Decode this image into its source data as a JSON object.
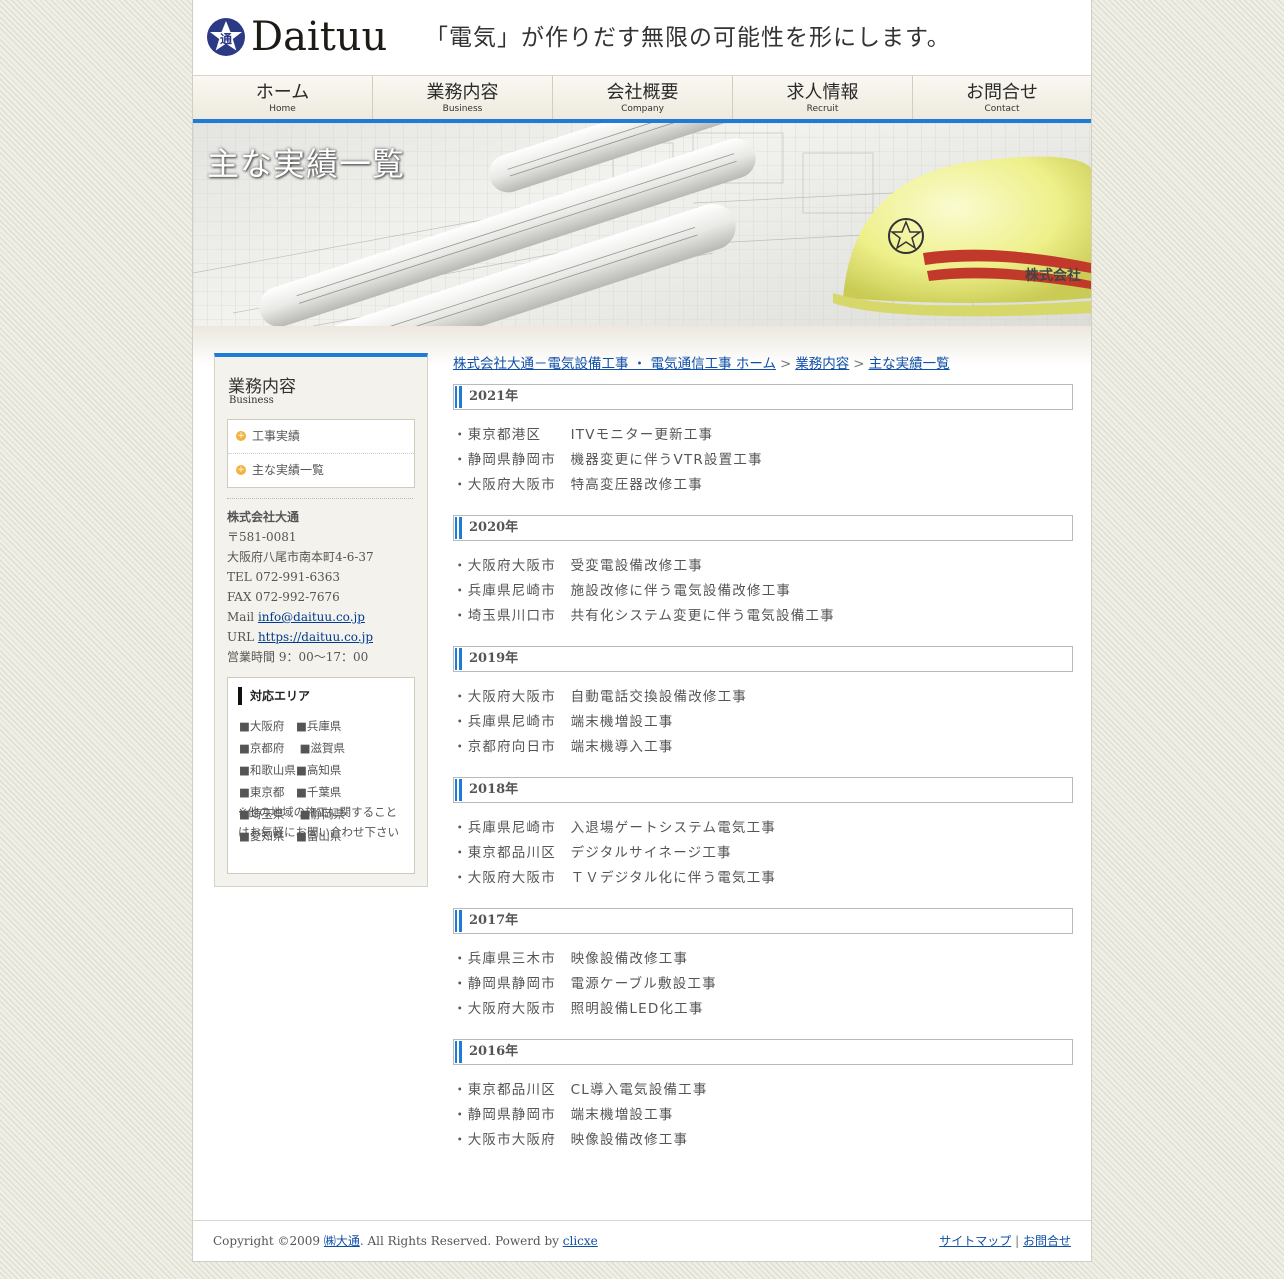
{
  "header": {
    "logo_mark_char": "通",
    "logo_text": "Daituu",
    "tagline": "「電気」が作りだす無限の可能性を形にします。"
  },
  "nav": [
    {
      "jp": "ホーム",
      "en": "Home"
    },
    {
      "jp": "業務内容",
      "en": "Business"
    },
    {
      "jp": "会社概要",
      "en": "Company"
    },
    {
      "jp": "求人情報",
      "en": "Recruit"
    },
    {
      "jp": "お問合せ",
      "en": "Contact"
    }
  ],
  "hero": {
    "title": "主な実績一覧",
    "helmet_text": "株式会社"
  },
  "sidebar": {
    "title": "業務内容",
    "title_en": "Business",
    "menu": [
      "工事実績",
      "主な実績一覧"
    ],
    "company": {
      "name": "株式会社大通",
      "zip": "〒581-0081",
      "address": "大阪府八尾市南本町4-6-37",
      "tel": "TEL 072-991-6363",
      "fax": "FAX 072-992-7676",
      "mail_label": "Mail",
      "mail": "info@daituu.co.jp",
      "url_label": "URL",
      "url": "https://daituu.co.jp",
      "hours": "営業時間 9：00～17：00"
    },
    "area": {
      "title": "対応エリア",
      "prefectures": [
        "■大阪府",
        "■兵庫県",
        "■京都府",
        "■滋賀県",
        "■和歌山県",
        "■高知県",
        "■東京都",
        "■千葉県",
        "■埼玉県",
        "■静岡県",
        "■愛知県",
        "■富山県"
      ],
      "note": "※他の地域の施工に関することはお気軽にお問い合わせ下さい"
    }
  },
  "breadcrumb": {
    "home": "株式会社大通－電気設備工事 ・ 電気通信工事 ホーム",
    "business": "業務内容",
    "current": "主な実績一覧",
    "sep": ">"
  },
  "years": [
    {
      "year": "2021年",
      "items": [
        "・東京都港区　　ITVモニター更新工事",
        "・静岡県静岡市　機器変更に伴うVTR設置工事",
        "・大阪府大阪市　特高変圧器改修工事"
      ]
    },
    {
      "year": "2020年",
      "items": [
        "・大阪府大阪市　受変電設備改修工事",
        "・兵庫県尼崎市　施設改修に伴う電気設備改修工事",
        "・埼玉県川口市　共有化システム変更に伴う電気設備工事"
      ]
    },
    {
      "year": "2019年",
      "items": [
        "・大阪府大阪市　自動電話交換設備改修工事",
        "・兵庫県尼崎市　端末機増設工事",
        "・京都府向日市　端末機導入工事"
      ]
    },
    {
      "year": "2018年",
      "items": [
        "・兵庫県尼崎市　入退場ゲートシステム電気工事",
        "・東京都品川区　デジタルサイネージ工事",
        "・大阪府大阪市　ＴＶデジタル化に伴う電気工事"
      ]
    },
    {
      "year": "2017年",
      "items": [
        "・兵庫県三木市　映像設備改修工事",
        "・静岡県静岡市　電源ケーブル敷設工事",
        "・大阪府大阪市　照明設備LED化工事"
      ]
    },
    {
      "year": "2016年",
      "items": [
        "・東京都品川区　CL導入電気設備工事",
        "・静岡県静岡市　端末機増設工事",
        "・大阪市大阪府　映像設備改修工事"
      ]
    }
  ],
  "footer": {
    "copyright_pre": "Copyright ©2009",
    "company_link": "㈱大通",
    "copyright_mid": ". All Rights Reserved. Powerd by",
    "powered_link": "clicxe",
    "sitemap": "サイトマップ",
    "sep": "|",
    "contact": "お問合せ"
  },
  "colors": {
    "accent": "#1f7bd8",
    "link": "#0f4fa8",
    "logo_blue": "#2c3a86"
  }
}
